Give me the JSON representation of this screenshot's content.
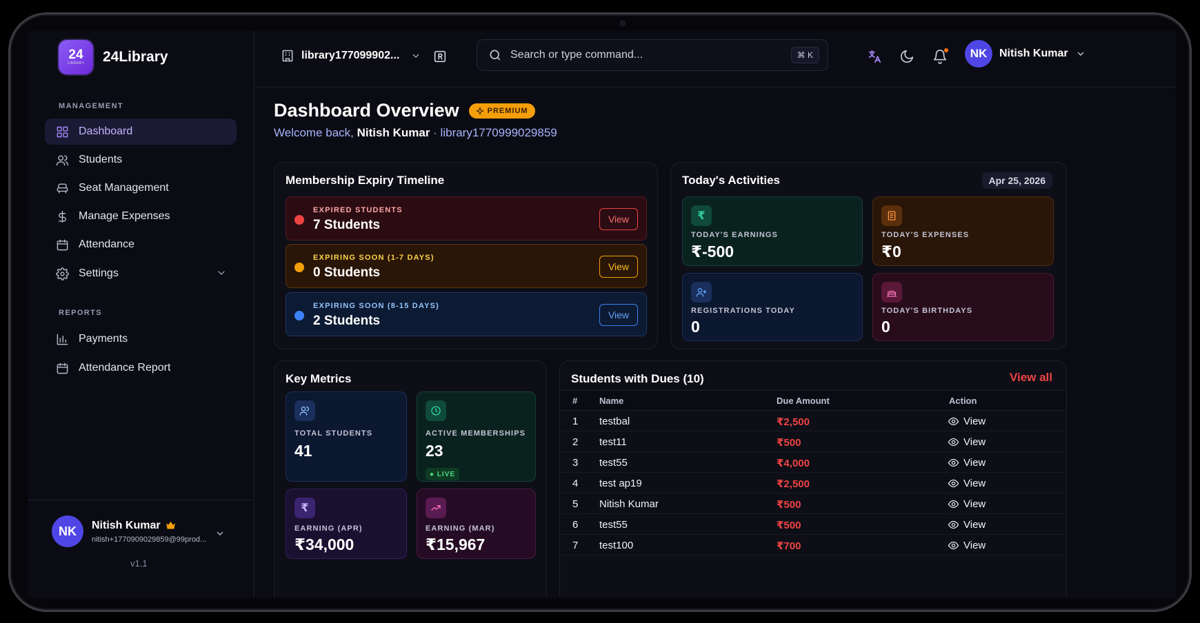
{
  "brand": {
    "logo_number": "24",
    "logo_sub": "LIBRARY",
    "name": "24Library"
  },
  "sidebar": {
    "management_label": "MANAGEMENT",
    "items": [
      {
        "label": "Dashboard",
        "icon": "grid-icon"
      },
      {
        "label": "Students",
        "icon": "users-icon"
      },
      {
        "label": "Seat Management",
        "icon": "seat-icon"
      },
      {
        "label": "Manage Expenses",
        "icon": "dollar-icon"
      },
      {
        "label": "Attendance",
        "icon": "calendar-icon"
      },
      {
        "label": "Settings",
        "icon": "gear-icon"
      }
    ],
    "reports_label": "REPORTS",
    "reports": [
      {
        "label": "Payments",
        "icon": "bar-chart-icon"
      },
      {
        "label": "Attendance Report",
        "icon": "calendar-icon"
      }
    ],
    "user": {
      "initials": "NK",
      "name": "Nitish Kumar",
      "email": "nitish+1770909029859@99prod...",
      "badge_icon": "crown-icon"
    },
    "version": "v1.1"
  },
  "topbar": {
    "library": "library177099902...",
    "search_placeholder": "Search or type command...",
    "shortcut": "⌘ K",
    "user": {
      "initials": "NK",
      "name": "Nitish Kumar"
    }
  },
  "header": {
    "title": "Dashboard Overview",
    "badge": "PREMIUM",
    "welcome_prefix": "Welcome back,",
    "welcome_name": "Nitish Kumar",
    "welcome_suffix": "· library1770999029859"
  },
  "expiry": {
    "title": "Membership Expiry Timeline",
    "rows": [
      {
        "label": "EXPIRED STUDENTS",
        "value": "7 Students",
        "button": "View",
        "color": "#ef4444"
      },
      {
        "label": "EXPIRING SOON (1-7 DAYS)",
        "value": "0 Students",
        "button": "View",
        "color": "#f59e0b"
      },
      {
        "label": "EXPIRING SOON (8-15 DAYS)",
        "value": "2 Students",
        "button": "View",
        "color": "#3b82f6"
      }
    ]
  },
  "activities": {
    "title": "Today's Activities",
    "date": "Apr 25, 2026",
    "tiles": [
      {
        "label": "TODAY'S EARNINGS",
        "value": "₹-500",
        "icon": "₹"
      },
      {
        "label": "TODAY'S EXPENSES",
        "value": "₹0",
        "icon": "receipt-icon"
      },
      {
        "label": "REGISTRATIONS TODAY",
        "value": "0",
        "icon": "user-plus-icon"
      },
      {
        "label": "TODAY'S BIRTHDAYS",
        "value": "0",
        "icon": "cake-icon"
      }
    ]
  },
  "metrics": {
    "title": "Key Metrics",
    "tiles": [
      {
        "label": "TOTAL STUDENTS",
        "value": "41",
        "icon": "users-icon"
      },
      {
        "label": "ACTIVE MEMBERSHIPS",
        "value": "23",
        "icon": "clock-icon",
        "tag": "● LIVE"
      },
      {
        "label": "EARNING (APR)",
        "value": "₹34,000",
        "icon": "₹"
      },
      {
        "label": "EARNING (MAR)",
        "value": "₹15,967",
        "icon": "trend-icon"
      }
    ]
  },
  "dues": {
    "title": "Students with Dues (10)",
    "view_all": "View all",
    "columns": [
      "#",
      "Name",
      "Due Amount",
      "Action"
    ],
    "rows": [
      {
        "num": "1",
        "name": "testbal",
        "amount": "₹2,500",
        "action": "View"
      },
      {
        "num": "2",
        "name": "test11",
        "amount": "₹500",
        "action": "View"
      },
      {
        "num": "3",
        "name": "test55",
        "amount": "₹4,000",
        "action": "View"
      },
      {
        "num": "4",
        "name": "test ap19",
        "amount": "₹2,500",
        "action": "View"
      },
      {
        "num": "5",
        "name": "Nitish Kumar",
        "amount": "₹500",
        "action": "View"
      },
      {
        "num": "6",
        "name": "test55",
        "amount": "₹500",
        "action": "View"
      },
      {
        "num": "7",
        "name": "test100",
        "amount": "₹700",
        "action": "View"
      }
    ]
  }
}
